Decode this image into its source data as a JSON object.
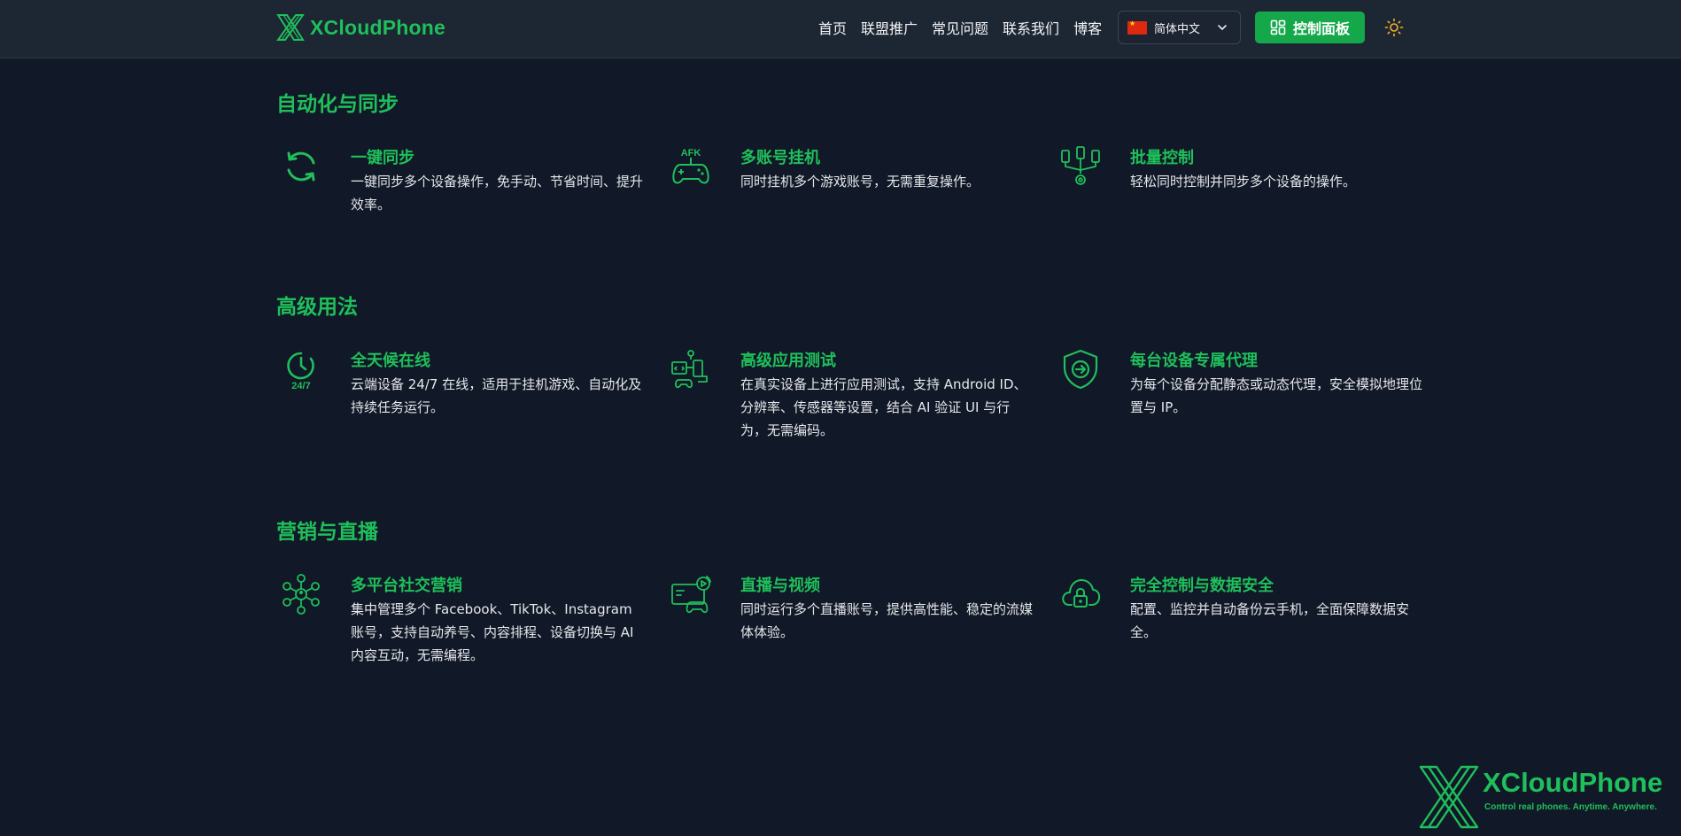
{
  "header": {
    "brand": "XCloudPhone",
    "nav": [
      "首页",
      "联盟推广",
      "常见问题",
      "联系我们",
      "博客"
    ],
    "language": "简体中文",
    "dashboard_label": "控制面板"
  },
  "sections": [
    {
      "title": "自动化与同步",
      "features": [
        {
          "title": "一键同步",
          "desc": "一键同步多个设备操作，免手动、节省时间、提升效率。",
          "icon": "sync-icon"
        },
        {
          "title": "多账号挂机",
          "desc": "同时挂机多个游戏账号，无需重复操作。",
          "icon": "afk-gamepad-icon",
          "icon_text": "AFK"
        },
        {
          "title": "批量控制",
          "desc": "轻松同时控制并同步多个设备的操作。",
          "icon": "batch-control-icon"
        }
      ]
    },
    {
      "title": "高级用法",
      "features": [
        {
          "title": "全天候在线",
          "desc": "云端设备 24/7 在线，适用于挂机游戏、自动化及持续任务运行。",
          "icon": "clock-24-7-icon",
          "icon_text": "24/7"
        },
        {
          "title": "高级应用测试",
          "desc": "在真实设备上进行应用测试，支持 Android ID、分辨率、传感器等设置，结合 AI 验证 UI 与行为，无需编码。",
          "icon": "app-testing-icon"
        },
        {
          "title": "每台设备专属代理",
          "desc": "为每个设备分配静态或动态代理，安全模拟地理位置与 IP。",
          "icon": "shield-proxy-icon"
        }
      ]
    },
    {
      "title": "营销与直播",
      "features": [
        {
          "title": "多平台社交营销",
          "desc": "集中管理多个 Facebook、TikTok、Instagram 账号，支持自动养号、内容排程、设备切换与 AI 内容互动，无需编程。",
          "icon": "social-network-icon"
        },
        {
          "title": "直播与视频",
          "desc": "同时运行多个直播账号，提供高性能、稳定的流媒体体验。",
          "icon": "live-stream-icon"
        },
        {
          "title": "完全控制与数据安全",
          "desc": "配置、监控并自动备份云手机，全面保障数据安全。",
          "icon": "cloud-lock-icon"
        }
      ]
    }
  ],
  "watermark": {
    "name": "XCloudPhone",
    "tagline": "Control real phones. Anytime. Anywhere."
  },
  "colors": {
    "accent": "#1fbf5b",
    "background": "#111827",
    "header": "#1d2633",
    "button": "#14a84b"
  }
}
